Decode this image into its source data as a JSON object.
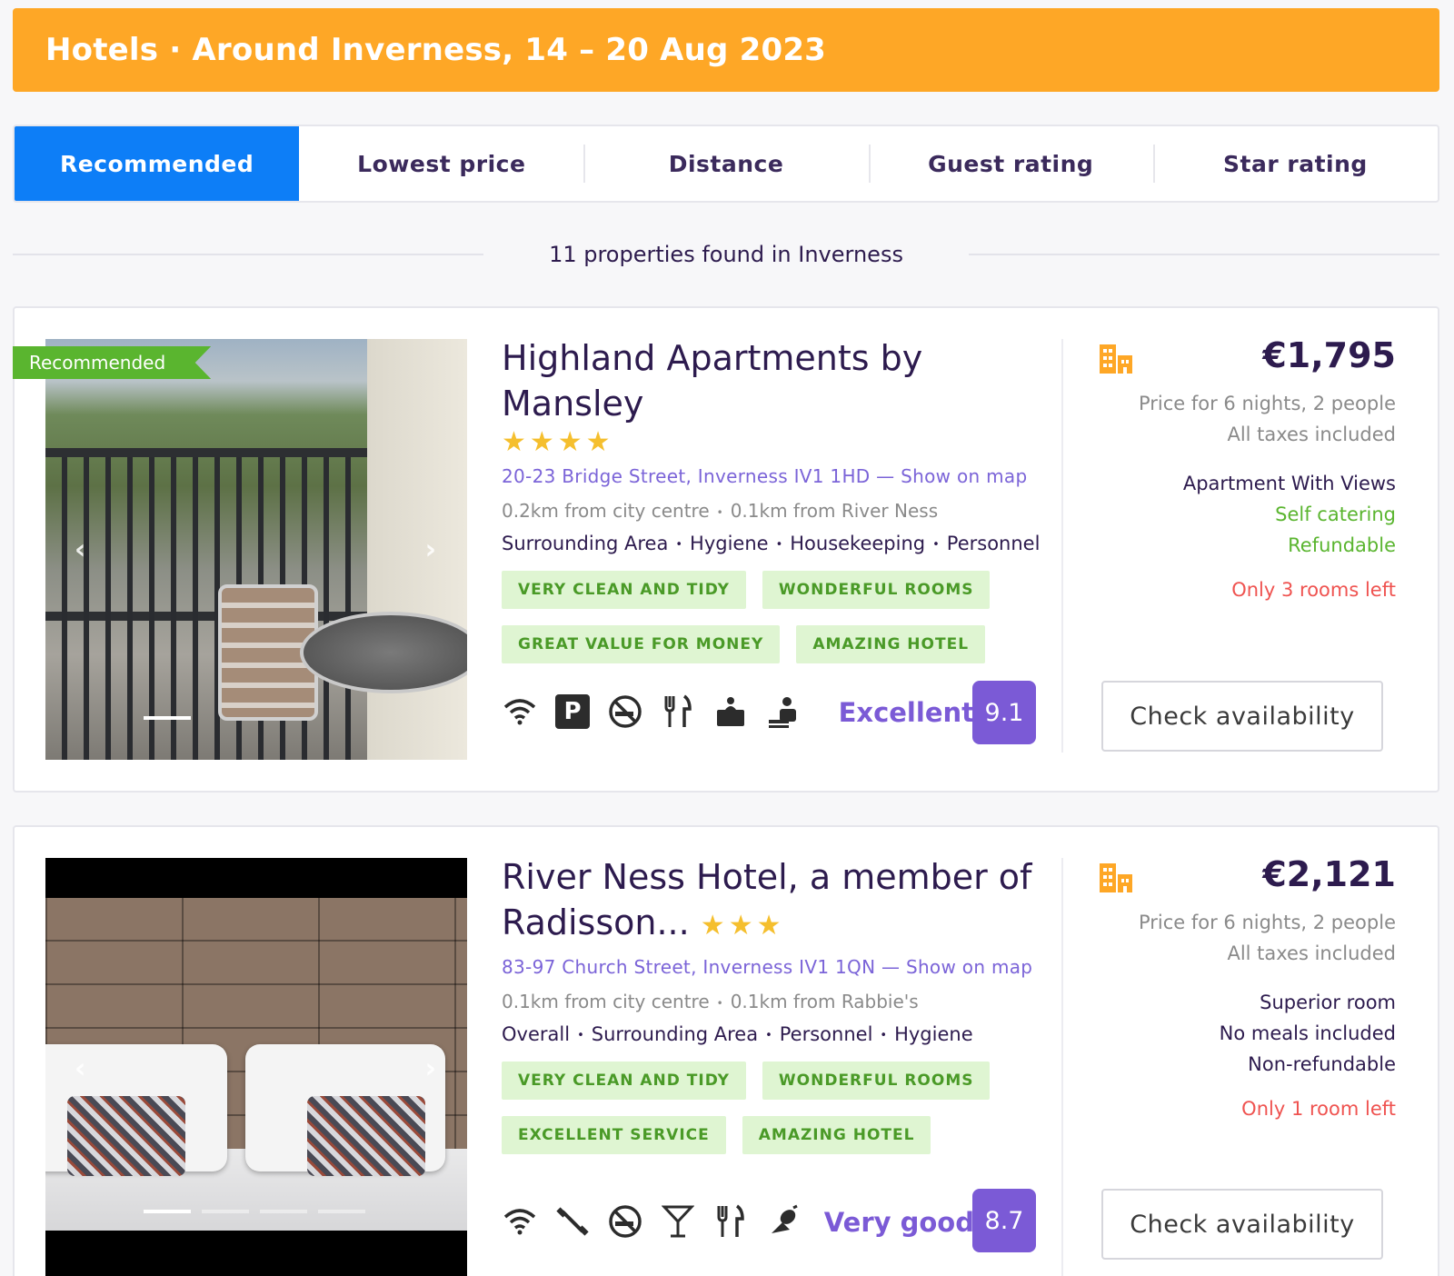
{
  "header": {
    "title": "Hotels · Around Inverness, 14 – 20 Aug 2023"
  },
  "sort_tabs": [
    {
      "label": "Recommended",
      "active": true
    },
    {
      "label": "Lowest price",
      "active": false
    },
    {
      "label": "Distance",
      "active": false
    },
    {
      "label": "Guest rating",
      "active": false
    },
    {
      "label": "Star rating",
      "active": false
    }
  ],
  "results_summary": "11 properties found in Inverness",
  "hotels": [
    {
      "ribbon": "Recommended",
      "name": "Highland Apartments by Mansley",
      "stars": "★★★★",
      "address": "20-23 Bridge Street, Inverness IV1 1HD — Show on map",
      "distances": [
        "0.2km from city centre",
        "0.1km from River Ness"
      ],
      "aspects": [
        "Surrounding Area",
        "Hygiene",
        "Housekeeping",
        "Personnel"
      ],
      "badges": [
        "VERY CLEAN AND TIDY",
        "WONDERFUL ROOMS",
        "GREAT VALUE FOR MONEY",
        "AMAZING HOTEL"
      ],
      "amenities": [
        "wifi-icon",
        "parking-icon",
        "no-smoking-icon",
        "restaurant-icon",
        "room-service-icon",
        "reception-icon"
      ],
      "rating_label": "Excellent",
      "rating_score": "9.1",
      "price": "€1,795",
      "price_note": "Price for 6 nights, 2 people",
      "taxes_note": "All taxes included",
      "room_type": "Apartment With Views",
      "meal_plan": "Self catering",
      "cancellation": "Refundable",
      "availability": "Only 3 rooms left",
      "cta": "Check availability"
    },
    {
      "name_line1": "River Ness Hotel, a member of",
      "name_line2": "Radisson...",
      "stars": "★★★",
      "address": "83-97 Church Street, Inverness IV1 1QN — Show on map",
      "distances": [
        "0.1km from city centre",
        "0.1km from Rabbie's"
      ],
      "aspects": [
        "Overall",
        "Surrounding Area",
        "Personnel",
        "Hygiene"
      ],
      "badges": [
        "VERY CLEAN AND TIDY",
        "WONDERFUL ROOMS",
        "EXCELLENT SERVICE",
        "AMAZING HOTEL"
      ],
      "amenities": [
        "wifi-icon",
        "fitness-icon",
        "no-smoking-icon",
        "bar-icon",
        "restaurant-icon",
        "pets-icon"
      ],
      "rating_label": "Very good",
      "rating_score": "8.7",
      "price": "€2,121",
      "price_note": "Price for 6 nights, 2 people",
      "taxes_note": "All taxes included",
      "room_type": "Superior room",
      "meal_plan": "No meals included",
      "cancellation": "Non-refundable",
      "availability": "Only 1 room left",
      "cta": "Check availability"
    }
  ],
  "colors": {
    "accent": "#0d7ef7",
    "header": "#fea726",
    "rating": "#7b5ad6",
    "badge_text": "#4a9a27",
    "urgency": "#ef5350"
  }
}
